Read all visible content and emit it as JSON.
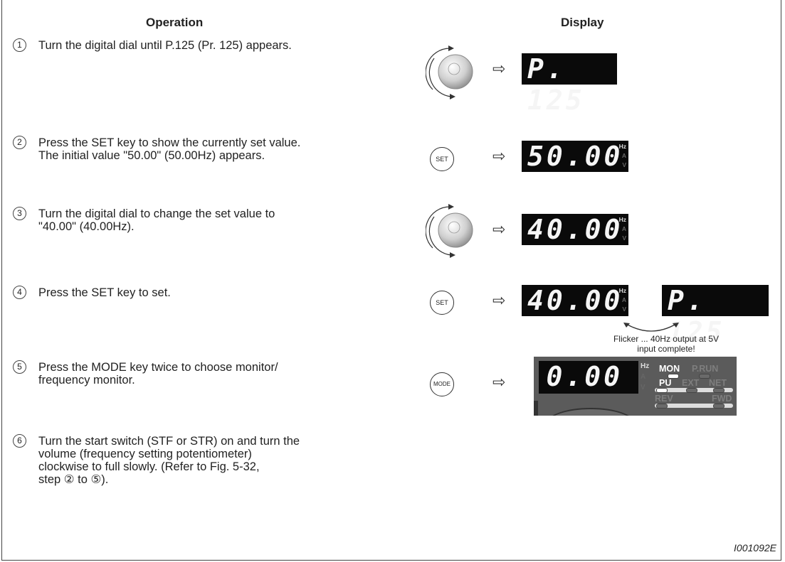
{
  "headers": {
    "operation": "Operation",
    "display": "Display"
  },
  "steps": [
    {
      "num": "1",
      "text": "Turn the digital dial until P.125 (Pr. 125) appears."
    },
    {
      "num": "2",
      "text": "Press the SET key to show the currently set value.\nThe initial value \"50.00\" (50.00Hz) appears."
    },
    {
      "num": "3",
      "text": "Turn the digital dial to change the set value to\n\"40.00\" (40.00Hz)."
    },
    {
      "num": "4",
      "text": "Press the SET key to set."
    },
    {
      "num": "5",
      "text": "Press the MODE key twice to choose monitor/\nfrequency monitor."
    },
    {
      "num": "6",
      "text": "Turn the start switch (STF or STR) on and turn the\nvolume (frequency setting potentiometer)\nclockwise to full slowly. (Refer to Fig. 5-32,\nstep ② to ⑤)."
    }
  ],
  "keys": {
    "set": "SET",
    "mode": "MODE"
  },
  "displays": {
    "d1": "P. 125",
    "d2": "50.00",
    "d3": "40.00",
    "d4a": "40.00",
    "d4b": "P. 125",
    "d5": "0.00"
  },
  "units": {
    "hz": "Hz",
    "a": "A",
    "v": "V"
  },
  "lamps": {
    "mon": "MON",
    "prun": "P.RUN",
    "pu": "PU",
    "ext": "EXT",
    "net": "NET",
    "rev": "REV",
    "fwd": "FWD"
  },
  "flicker_caption": "Flicker ... 40Hz output at 5V\ninput complete!",
  "arrow_glyph": "⇨",
  "reference_code": "I001092E",
  "icons": {
    "dial": "digital-dial-icon",
    "arrow": "right-arrow-icon"
  }
}
